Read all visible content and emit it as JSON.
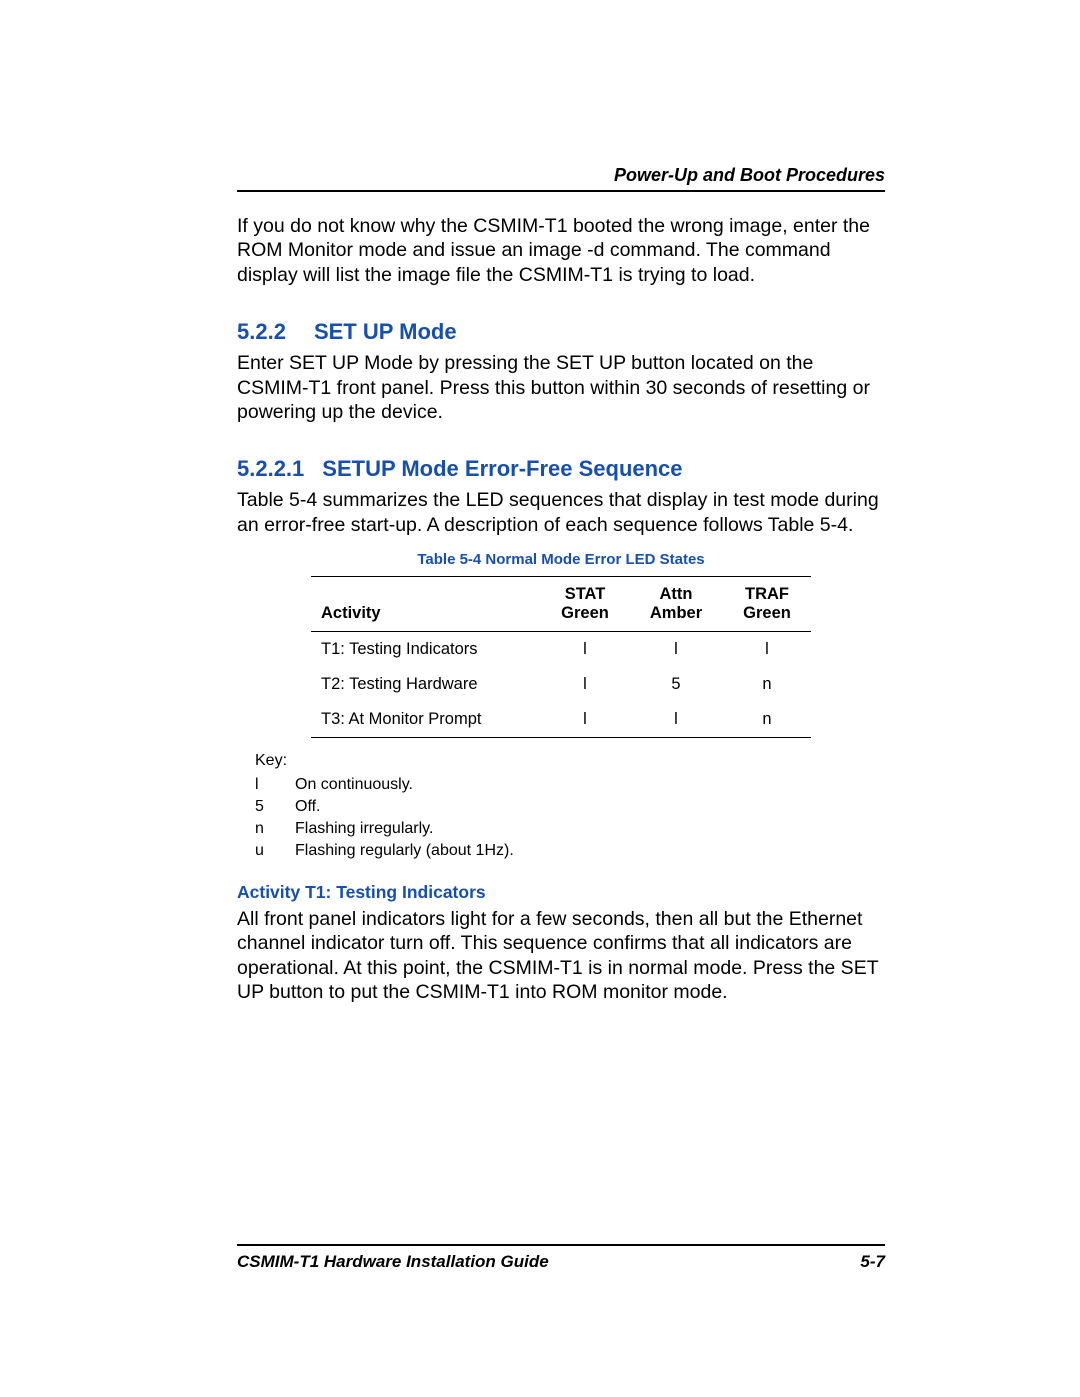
{
  "header": {
    "chapter_title": "Power-Up and Boot Procedures"
  },
  "intro": "If you do not know why the CSMIM-T1 booted the wrong image, enter the ROM Monitor mode and issue an image -d command. The command display will list the image ﬁle the CSMIM-T1 is trying to load.",
  "section_522": {
    "number": "5.2.2",
    "title": "SET UP Mode",
    "text": "Enter SET UP Mode by pressing the SET UP button located on the CSMIM-T1 front panel. Press this button within 30 seconds of resetting or powering up the device."
  },
  "section_5221": {
    "number": "5.2.2.1",
    "title": "SETUP Mode Error-Free Sequence",
    "text": "Table 5-4 summarizes the LED sequences that display in test mode during an error-free start-up. A description of each sequence follows Table 5-4."
  },
  "table_caption": "Table 5-4   Normal Mode Error LED States",
  "table": {
    "headers": {
      "activity": "Activity",
      "stat1": "STAT",
      "stat2": "Green",
      "attn1": "Attn",
      "attn2": "Amber",
      "traf1": "TRAF",
      "traf2": "Green"
    },
    "rows": [
      {
        "activity": "T1: Testing Indicators",
        "stat": "l",
        "attn": "l",
        "traf": "l"
      },
      {
        "activity": "T2: Testing Hardware",
        "stat": "l",
        "attn": "5",
        "traf": "n"
      },
      {
        "activity": "T3: At Monitor Prompt",
        "stat": "l",
        "attn": "l",
        "traf": "n"
      }
    ]
  },
  "key": {
    "label": "Key:",
    "items": [
      {
        "sym": "l",
        "desc": "On continuously."
      },
      {
        "sym": "5",
        "desc": "Off."
      },
      {
        "sym": "n",
        "desc": "Flashing irregularly."
      },
      {
        "sym": "u",
        "desc": "Flashing regularly (about 1Hz)."
      }
    ]
  },
  "activity_t1": {
    "title": "Activity T1: Testing Indicators",
    "text": "All front panel indicators light for a few seconds, then all but the Ethernet channel indicator turn off. This sequence conﬁrms that all indicators are operational. At this point, the CSMIM-T1 is in normal mode. Press the SET UP button to put the CSMIM-T1 into ROM monitor mode."
  },
  "footer": {
    "guide": "CSMIM-T1 Hardware Installation Guide",
    "page": "5-7"
  }
}
